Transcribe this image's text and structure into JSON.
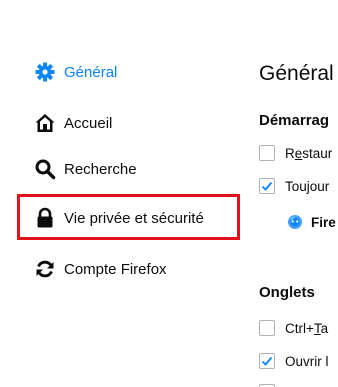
{
  "sidebar": {
    "items": [
      {
        "label": "Général",
        "icon": "gear-icon",
        "selected": true
      },
      {
        "label": "Accueil",
        "icon": "home-icon",
        "selected": false
      },
      {
        "label": "Recherche",
        "icon": "search-icon",
        "selected": false
      },
      {
        "label": "Vie privée et sécurité",
        "icon": "lock-icon",
        "selected": false,
        "highlighted": true
      },
      {
        "label": "Compte Firefox",
        "icon": "sync-icon",
        "selected": false
      }
    ]
  },
  "main": {
    "title": "Général",
    "startup": {
      "heading": "Démarrag",
      "restore_first": "R",
      "restore_underlined": "e",
      "restore_rest": "staur",
      "default_label": "Toujour",
      "firefox_label": "Fire"
    },
    "tabs": {
      "heading": "Onglets",
      "ctrltab_prefix": "Ctrl+",
      "ctrltab_underlined": "T",
      "ctrltab_rest": "a",
      "open_label": "Ouvrir l"
    }
  },
  "colors": {
    "accent": "#0a84ff",
    "highlight": "#e5121b",
    "text": "#0c0c0d"
  }
}
